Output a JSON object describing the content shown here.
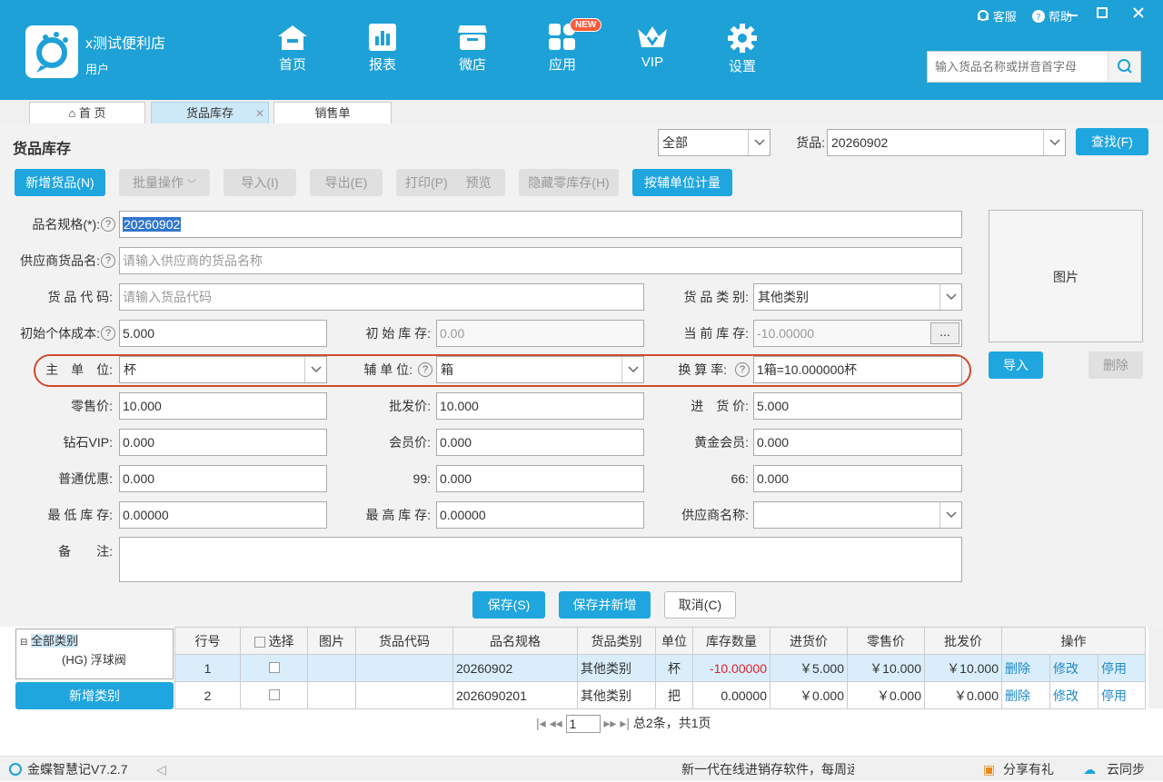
{
  "header": {
    "shop_name": "x测试便利店",
    "user": "用户",
    "support": "客服",
    "help": "帮助",
    "nav": [
      {
        "label": "首页",
        "icon": "home-icon"
      },
      {
        "label": "报表",
        "icon": "chart-icon"
      },
      {
        "label": "微店",
        "icon": "shop-icon"
      },
      {
        "label": "应用",
        "icon": "apps-icon"
      },
      {
        "label": "VIP",
        "icon": "vip-crown-icon"
      },
      {
        "label": "设置",
        "icon": "gear-icon"
      }
    ],
    "new_badge": "NEW",
    "search_placeholder": "输入货品名称或拼音首字母"
  },
  "tabs": [
    {
      "label": "首 页"
    },
    {
      "label": "货品库存"
    },
    {
      "label": "销售单"
    }
  ],
  "page": {
    "title": "货品库存",
    "filter_value": "全部",
    "goods_label": "货品:",
    "goods_value": "20260902",
    "find": "查找(F)"
  },
  "toolbar": {
    "add": "新增货品(N)",
    "batch": "批量操作",
    "import": "导入(I)",
    "export": "导出(E)",
    "print": "打印(P)",
    "preview": "预览",
    "hide_zero": "隐藏零库存(H)",
    "aux_unit": "按辅单位计量"
  },
  "form": {
    "name_label": "品名规格(*):",
    "name_value": "20260902",
    "supplier_name_label": "供应商货品名:",
    "supplier_name_ph": "请输入供应商的货品名称",
    "code_label": "货 品 代 码:",
    "code_ph": "请输入货品代码",
    "category_label": "货 品 类 别:",
    "category_value": "其他类别",
    "init_cost_label": "初始个体成本:",
    "init_cost_value": "5.000",
    "init_stock_label": "初 始 库 存:",
    "init_stock_ph": "0.00",
    "cur_stock_label": "当 前 库 存:",
    "cur_stock_value": "-10.00000",
    "more": "...",
    "main_unit_label": "主　单　位:",
    "main_unit_value": "杯",
    "aux_unit_label": "辅 单 位:",
    "aux_unit_value": "箱",
    "rate_label": "换 算 率:",
    "rate_value": "1箱=10.000000杯",
    "retail_label": "零售价:",
    "retail_value": "10.000",
    "wholesale_label": "批发价:",
    "wholesale_value": "10.000",
    "purchase_label": "进　货 价:",
    "purchase_value": "5.000",
    "diamond_label": "钻石VIP:",
    "diamond_value": "0.000",
    "member_label": "会员价:",
    "member_value": "0.000",
    "gold_label": "黄金会员:",
    "gold_value": "0.000",
    "normal_label": "普通优惠:",
    "normal_value": "0.000",
    "p99_label": "99:",
    "p99_value": "0.000",
    "p66_label": "66:",
    "p66_value": "0.000",
    "min_label": "最 低 库 存:",
    "min_value": "0.00000",
    "max_label": "最 高 库 存:",
    "max_value": "0.00000",
    "supplier_label": "供应商名称:",
    "remark_label": "备　　注:",
    "image_label": "图片",
    "img_import": "导入",
    "img_delete": "删除",
    "save": "保存(S)",
    "save_new": "保存并新增",
    "cancel": "取消(C)"
  },
  "tree": {
    "root": "全部类别",
    "child": "(HG) 浮球阀",
    "add_category": "新增类别"
  },
  "table": {
    "headers": [
      "行号",
      "选择",
      "图片",
      "货品代码",
      "品名规格",
      "货品类别",
      "单位",
      "库存数量",
      "进货价",
      "零售价",
      "批发价",
      "操作"
    ],
    "rows": [
      {
        "no": "1",
        "code": "",
        "name": "20260902",
        "cat": "其他类别",
        "unit": "杯",
        "stock": "-10.00000",
        "buy": "￥5.000",
        "retail": "￥10.000",
        "whole": "￥10.000"
      },
      {
        "no": "2",
        "code": "",
        "name": "2026090201",
        "cat": "其他类别",
        "unit": "把",
        "stock": "0.00000",
        "buy": "￥0.000",
        "retail": "￥0.000",
        "whole": "￥0.000"
      }
    ],
    "op_delete": "删除",
    "op_edit": "修改",
    "op_stop": "停用"
  },
  "pager": {
    "page": "1",
    "summary": "总2条，共1页"
  },
  "status": {
    "version": "金蝶智慧记V7.2.7",
    "marquee": "新一代在线进销存软件，每周运",
    "share": "分享有礼",
    "sync": "云同步"
  },
  "colors": {
    "brand": "#1da1d7",
    "accent_red": "#d04a2e",
    "negative": "#e0202a"
  }
}
